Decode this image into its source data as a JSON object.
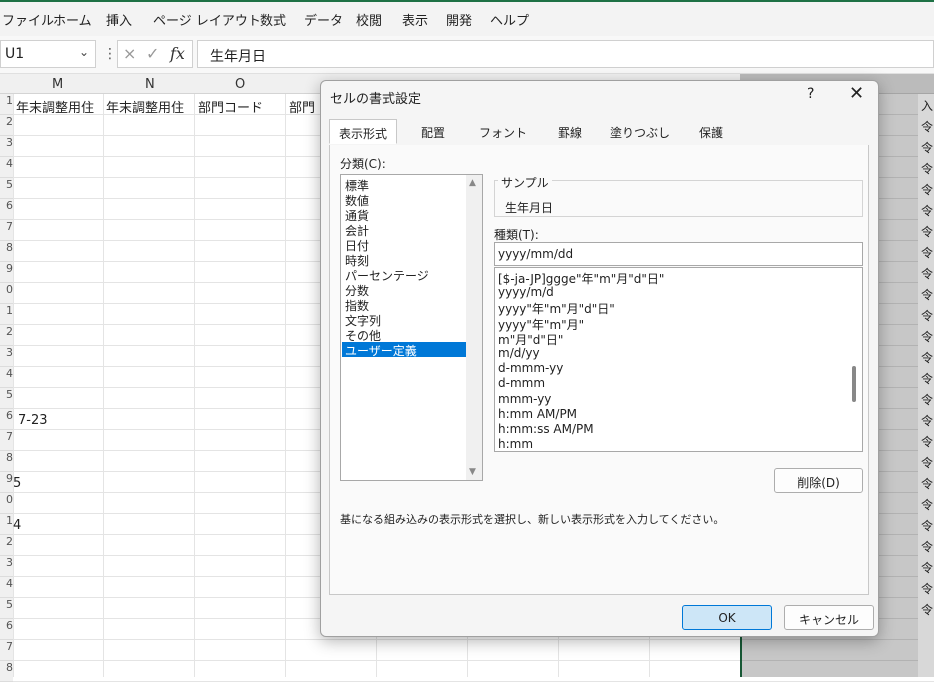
{
  "ribbon": {
    "tabs": [
      "ファイル",
      "ホーム",
      "挿入",
      "ページ レイアウト",
      "数式",
      "データ",
      "校閲",
      "表示",
      "開発",
      "ヘルプ"
    ]
  },
  "formula_bar": {
    "name_box": "U1",
    "separator": "⋮",
    "cancel_icon": "×",
    "enter_icon": "✓",
    "fx_label": "fx",
    "content": "生年月日"
  },
  "sheet": {
    "columns": [
      "M",
      "N",
      "O"
    ],
    "row_numbers": [
      "1",
      "2",
      "3",
      "4",
      "5",
      "6",
      "7",
      "8",
      "9",
      "0",
      "1",
      "2",
      "3",
      "4",
      "5",
      "6",
      "7",
      "8",
      "9",
      "0",
      "1",
      "2",
      "3",
      "4",
      "5",
      "6",
      "7",
      "8"
    ],
    "header_cells": [
      "年末調整用住",
      "年末調整用住",
      "部門コード",
      "部門"
    ],
    "cell_m16": "7-23",
    "cell_l19": "5",
    "cell_l21": "4",
    "right_col_header": "入",
    "right_col_values": [
      "令",
      "令",
      "令",
      "令",
      "令",
      "令",
      "令",
      "令",
      "令",
      "令",
      "令",
      "令",
      "令",
      "令",
      "令",
      "令",
      "令",
      "令",
      "令",
      "令",
      "令",
      "令",
      "令",
      "令"
    ]
  },
  "dialog": {
    "title": "セルの書式設定",
    "help": "?",
    "close": "✕",
    "tabs": [
      "表示形式",
      "配置",
      "フォント",
      "罫線",
      "塗りつぶし",
      "保護"
    ],
    "category_label": "分類(C):",
    "categories": [
      "標準",
      "数値",
      "通貨",
      "会計",
      "日付",
      "時刻",
      "パーセンテージ",
      "分数",
      "指数",
      "文字列",
      "その他",
      "ユーザー定義"
    ],
    "selected_category": "ユーザー定義",
    "sample_label": "サンプル",
    "sample_value": "生年月日",
    "type_label": "種類(T):",
    "type_value": "yyyy/mm/dd",
    "formats": [
      "[$-ja-JP]ggge\"年\"m\"月\"d\"日\"",
      "yyyy/m/d",
      "yyyy\"年\"m\"月\"d\"日\"",
      "yyyy\"年\"m\"月\"",
      "m\"月\"d\"日\"",
      "m/d/yy",
      "d-mmm-yy",
      "d-mmm",
      "mmm-yy",
      "h:mm AM/PM",
      "h:mm:ss AM/PM",
      "h:mm"
    ],
    "delete_button": "削除(D)",
    "hint": "基になる組み込みの表示形式を選択し、新しい表示形式を入力してください。",
    "ok_button": "OK",
    "cancel_button": "キャンセル"
  }
}
